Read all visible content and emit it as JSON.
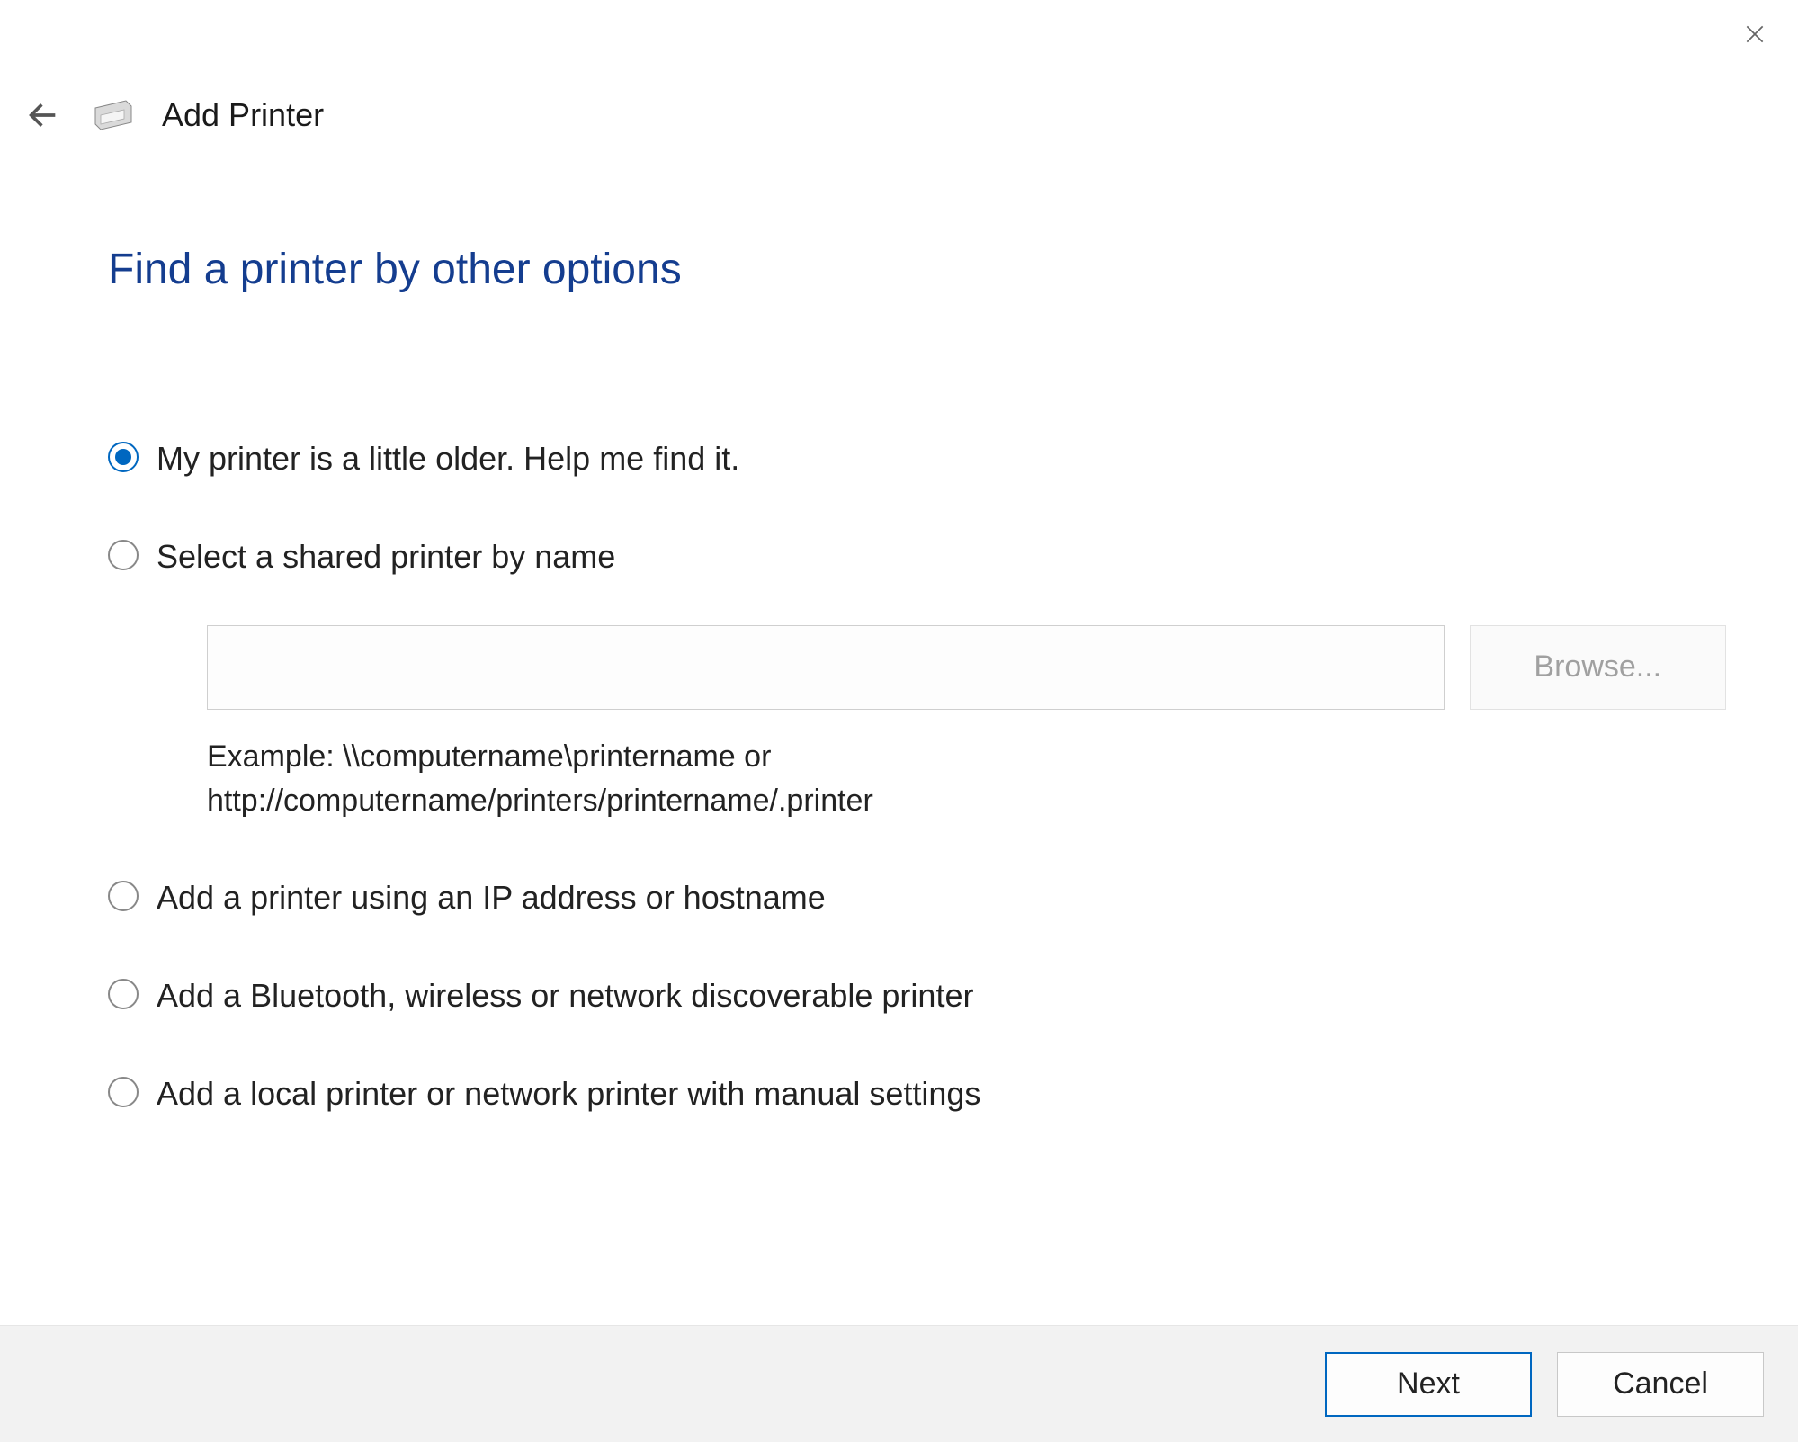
{
  "wizard": {
    "title": "Add Printer"
  },
  "page": {
    "heading": "Find a printer by other options"
  },
  "options": {
    "older_printer": {
      "label": "My printer is a little older. Help me find it.",
      "selected": true
    },
    "shared_by_name": {
      "label": "Select a shared printer by name",
      "selected": false,
      "input_value": "",
      "browse_label": "Browse...",
      "example": "Example: \\\\computername\\printername or\nhttp://computername/printers/printername/.printer"
    },
    "ip_hostname": {
      "label": "Add a printer using an IP address or hostname",
      "selected": false
    },
    "bluetooth_wireless": {
      "label": "Add a Bluetooth, wireless or network discoverable printer",
      "selected": false
    },
    "local_manual": {
      "label": "Add a local printer or network printer with manual settings",
      "selected": false
    }
  },
  "footer": {
    "next_label": "Next",
    "cancel_label": "Cancel"
  }
}
